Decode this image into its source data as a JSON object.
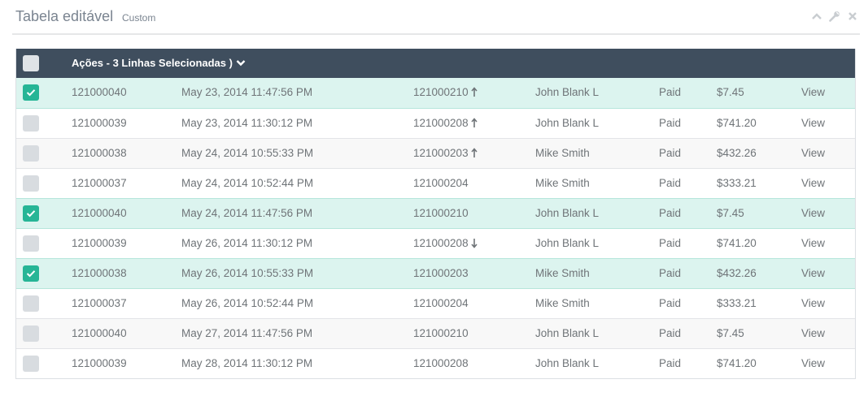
{
  "widget": {
    "title": "Tabela editável",
    "subtitle": "Custom",
    "tools": [
      "chevron-up-icon",
      "wrench-icon",
      "close-icon"
    ]
  },
  "table": {
    "actions_label": "Ações - 3 Linhas Selecionadas )",
    "rows": [
      {
        "id": "121000040",
        "date": "May 23, 2014 11:47:56 PM",
        "ref": "121000210",
        "arrow": "up",
        "name": "John Blank L",
        "status": "Paid",
        "amount": "$7.45",
        "view": "View",
        "checked": true
      },
      {
        "id": "121000039",
        "date": "May 23, 2014 11:30:12 PM",
        "ref": "121000208",
        "arrow": "up",
        "name": "John Blank L",
        "status": "Paid",
        "amount": "$741.20",
        "view": "View",
        "checked": false
      },
      {
        "id": "121000038",
        "date": "May 24, 2014 10:55:33 PM",
        "ref": "121000203",
        "arrow": "up",
        "name": "Mike Smith",
        "status": "Paid",
        "amount": "$432.26",
        "view": "View",
        "checked": false
      },
      {
        "id": "121000037",
        "date": "May 24, 2014 10:52:44 PM",
        "ref": "121000204",
        "arrow": "",
        "name": "Mike Smith",
        "status": "Paid",
        "amount": "$333.21",
        "view": "View",
        "checked": false
      },
      {
        "id": "121000040",
        "date": "May 24, 2014 11:47:56 PM",
        "ref": "121000210",
        "arrow": "",
        "name": "John Blank L",
        "status": "Paid",
        "amount": "$7.45",
        "view": "View",
        "checked": true
      },
      {
        "id": "121000039",
        "date": "May 26, 2014 11:30:12 PM",
        "ref": "121000208",
        "arrow": "down",
        "name": "John Blank L",
        "status": "Paid",
        "amount": "$741.20",
        "view": "View",
        "checked": false
      },
      {
        "id": "121000038",
        "date": "May 26, 2014 10:55:33 PM",
        "ref": "121000203",
        "arrow": "",
        "name": "Mike Smith",
        "status": "Paid",
        "amount": "$432.26",
        "view": "View",
        "checked": true
      },
      {
        "id": "121000037",
        "date": "May 26, 2014 10:52:44 PM",
        "ref": "121000204",
        "arrow": "",
        "name": "Mike Smith",
        "status": "Paid",
        "amount": "$333.21",
        "view": "View",
        "checked": false
      },
      {
        "id": "121000040",
        "date": "May 27, 2014 11:47:56 PM",
        "ref": "121000210",
        "arrow": "",
        "name": "John Blank L",
        "status": "Paid",
        "amount": "$7.45",
        "view": "View",
        "checked": false
      },
      {
        "id": "121000039",
        "date": "May 28, 2014 11:30:12 PM",
        "ref": "121000208",
        "arrow": "",
        "name": "John Blank L",
        "status": "Paid",
        "amount": "$741.20",
        "view": "View",
        "checked": false
      }
    ]
  },
  "colors": {
    "header_bg": "#3f4e5e",
    "selected_row_bg": "#dcf4ef",
    "checkbox_checked": "#26b596",
    "checkbox_unchecked": "#d8dce0"
  }
}
